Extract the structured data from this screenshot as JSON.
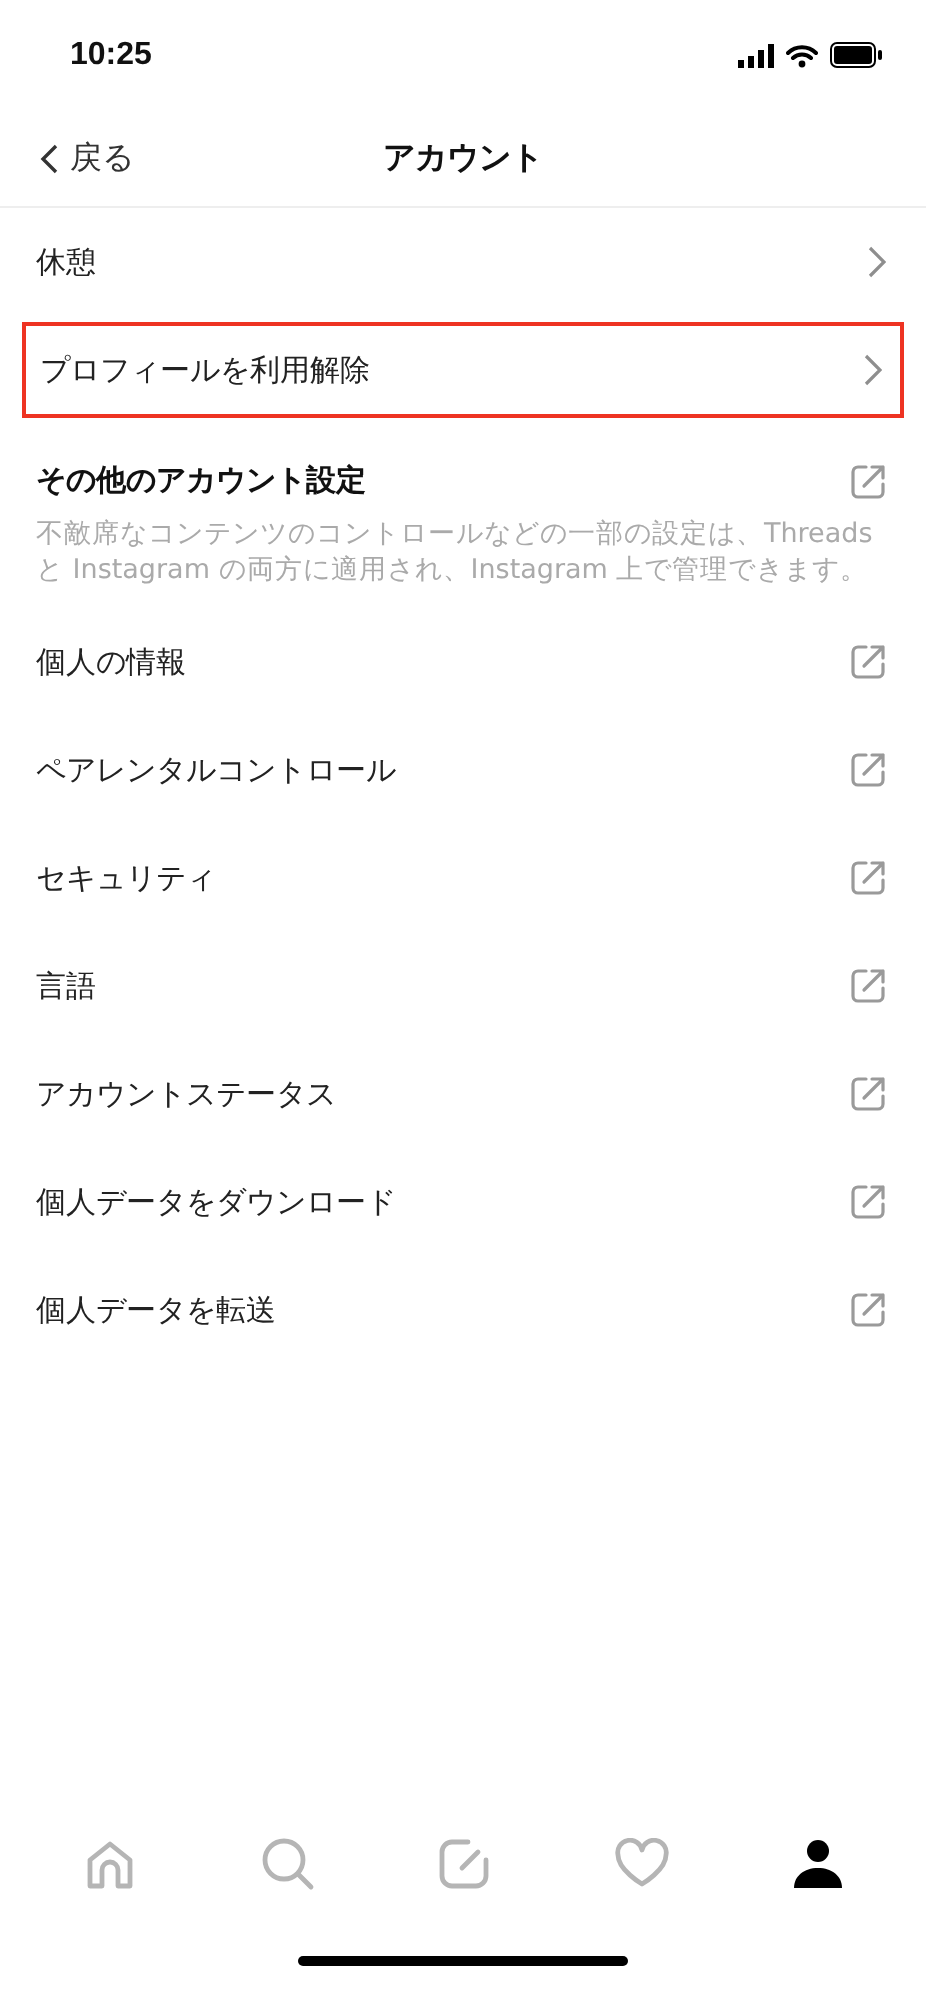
{
  "status_bar": {
    "time": "10:25"
  },
  "nav": {
    "back": "戻る",
    "title": "アカウント"
  },
  "rows": [
    {
      "label": "休憩",
      "kind": "chevron",
      "highlighted": false
    },
    {
      "label": "プロフィールを利用解除",
      "kind": "chevron",
      "highlighted": true
    }
  ],
  "section": {
    "title": "その他のアカウント設定",
    "description": "不敵席なコンテンツのコントロールなどの一部の設定は、Threads と Instagram の両方に適用され、Instagram 上で管理できます。"
  },
  "section_rows": [
    {
      "label": "個人の情報",
      "kind": "external"
    },
    {
      "label": "ペアレンタルコントロール",
      "kind": "external"
    },
    {
      "label": "セキュリティ",
      "kind": "external"
    },
    {
      "label": "言語",
      "kind": "external"
    },
    {
      "label": "アカウントステータス",
      "kind": "external"
    },
    {
      "label": "個人データをダウンロード",
      "kind": "external"
    },
    {
      "label": "個人データを転送",
      "kind": "external"
    }
  ],
  "tab_bar": [
    {
      "kind": "home",
      "selected": false
    },
    {
      "kind": "search",
      "selected": false
    },
    {
      "kind": "compose",
      "selected": false
    },
    {
      "kind": "activity",
      "selected": false
    },
    {
      "kind": "profile",
      "selected": true
    }
  ]
}
